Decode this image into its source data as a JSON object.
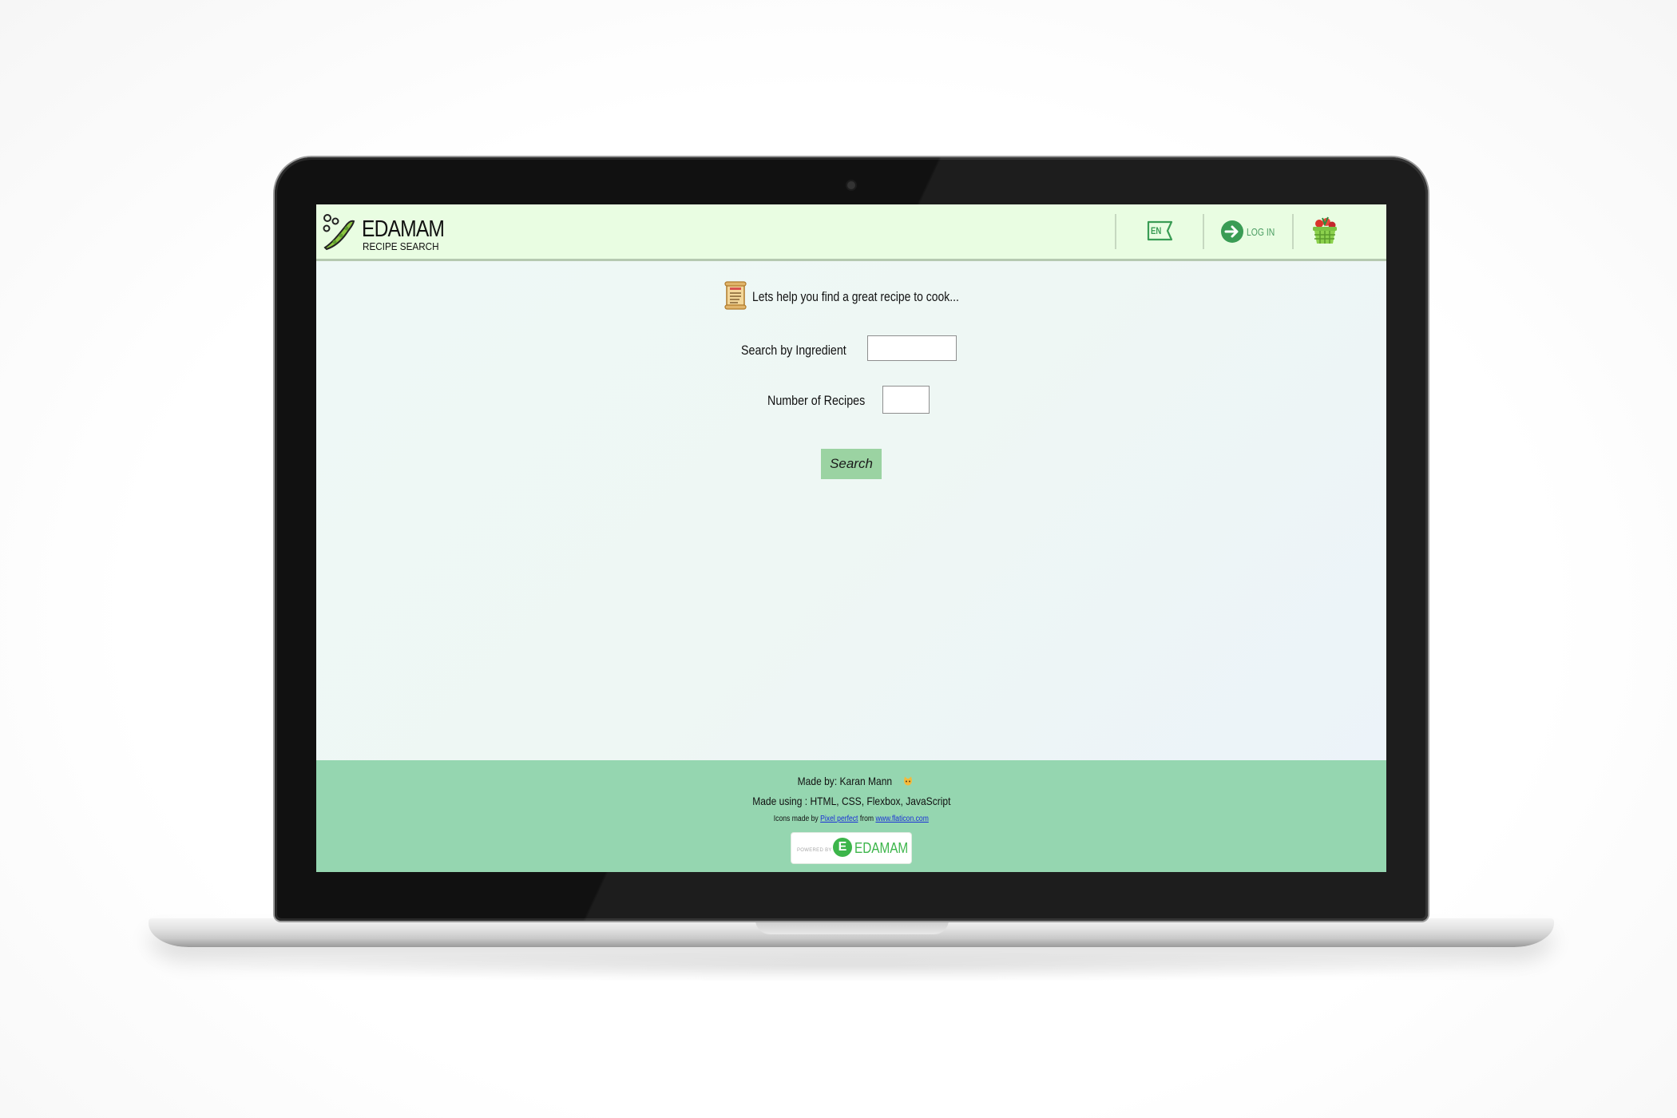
{
  "header": {
    "logo_title": "EDAMAM",
    "logo_subtitle": "RECIPE SEARCH",
    "language": "EN",
    "login_label": "LOG IN"
  },
  "main": {
    "intro_text": "Lets help you find a great recipe to cook...",
    "ingredient_label": "Search by Ingredient",
    "ingredient_value": "",
    "recipes_label": "Number of Recipes",
    "recipes_value": "",
    "search_label": "Search"
  },
  "footer": {
    "made_by": "Made by: Karan Mann",
    "made_using": "Made using : HTML, CSS, Flexbox, JavaScript",
    "icons_made_by": "Icons made by",
    "icons_author": "Pixel perfect",
    "icons_from": "from",
    "icons_site": "www.flaticon.com",
    "powered_by": "POWERED BY",
    "powered_letter": "E",
    "powered_brand": "EDAMAM"
  },
  "colors": {
    "header_bg": "#e9fde2",
    "footer_bg": "#95d6b0",
    "button_bg": "#9bd3a2",
    "brand_green": "#3cb54a"
  },
  "icons": {
    "logo": "green-bean-icon",
    "language": "flag-icon",
    "login": "arrow-right-circle-icon",
    "basket": "basket-icon",
    "intro": "recipe-scroll-icon",
    "made_by": "cat-emoji-icon"
  }
}
